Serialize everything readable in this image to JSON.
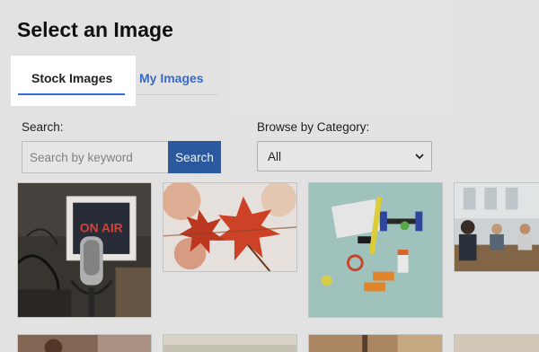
{
  "dialog": {
    "title": "Select an Image"
  },
  "tabs": [
    {
      "label": "Stock Images",
      "active": true
    },
    {
      "label": "My Images",
      "active": false
    }
  ],
  "search": {
    "label": "Search:",
    "placeholder": "Search by keyword",
    "value": "",
    "button_label": "Search"
  },
  "category": {
    "label": "Browse by Category:",
    "selected": "All"
  },
  "onair_sign": "ON AIR",
  "images": [
    {
      "subject": "on-air-microphone"
    },
    {
      "subject": "red-autumn-leaves"
    },
    {
      "subject": "fitness-flatlay"
    },
    {
      "subject": "office-people"
    },
    {
      "subject": "partial-bottom-1"
    },
    {
      "subject": "partial-bottom-2"
    },
    {
      "subject": "partial-bottom-3"
    },
    {
      "subject": "partial-bottom-4"
    }
  ],
  "colors": {
    "accent": "#2f6fd9",
    "search_button": "#2e5ea8",
    "tab_inactive": "#3a6fd3",
    "background": "#efefef"
  }
}
